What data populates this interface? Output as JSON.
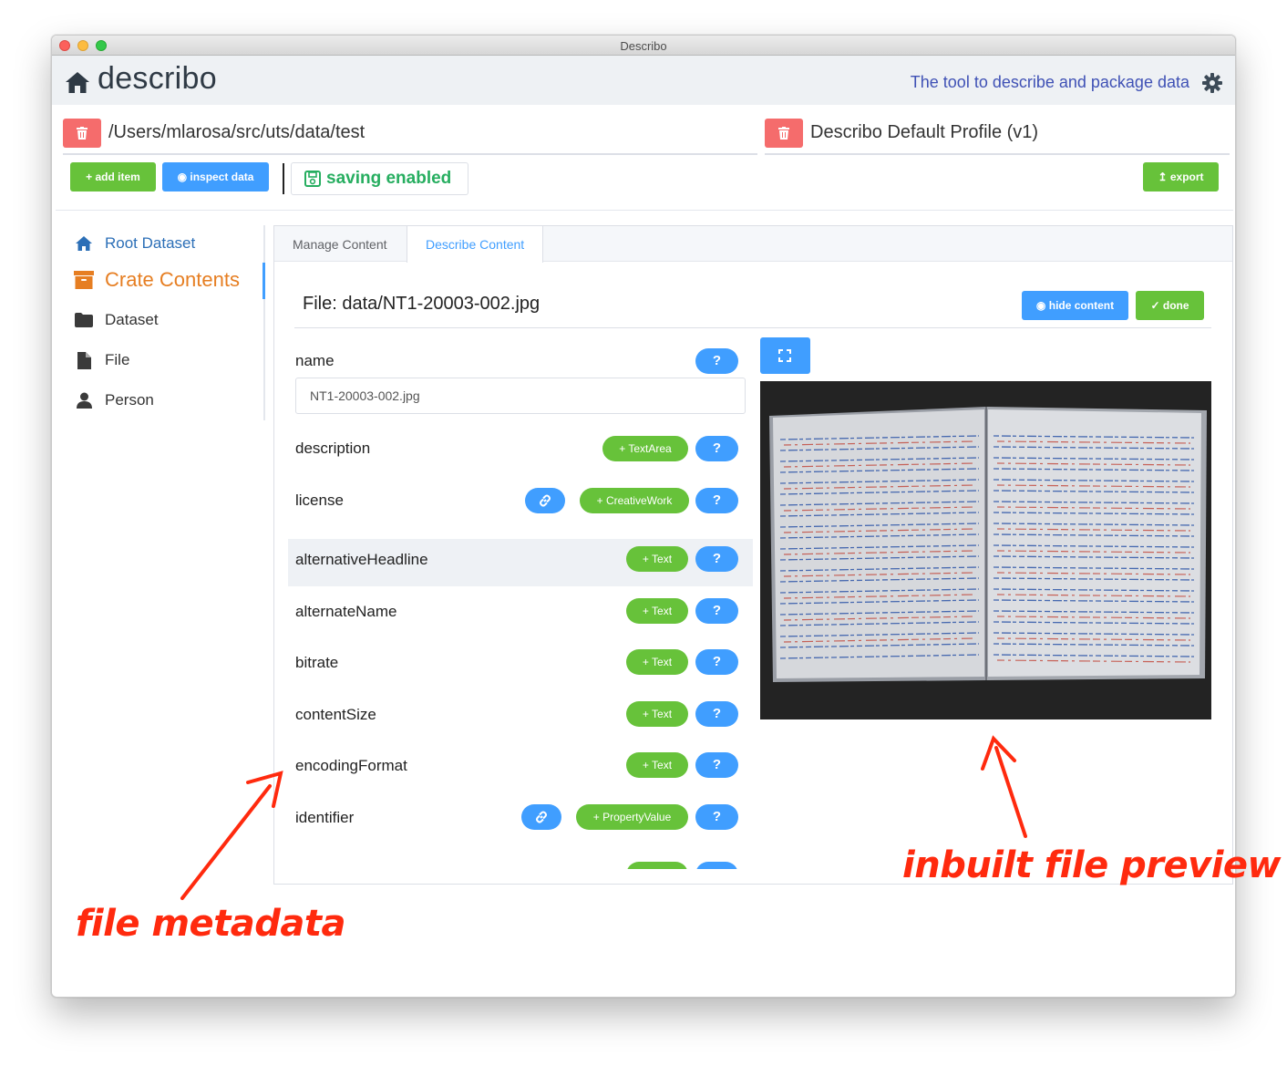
{
  "window": {
    "title": "Describo"
  },
  "header": {
    "app_name": "describo",
    "tagline": "The tool to describe and package data"
  },
  "paths": {
    "folder": "/Users/mlarosa/src/uts/data/test",
    "profile": "Describo Default Profile (v1)"
  },
  "toolbar": {
    "add_item": "add item",
    "inspect_data": "inspect data",
    "saving": "saving enabled",
    "export": "export"
  },
  "sidebar": {
    "items": [
      {
        "label": "Root Dataset",
        "icon": "home-icon",
        "color": "#2c6fb7"
      },
      {
        "label": "Crate Contents",
        "icon": "archive-icon",
        "color": "#e67e22",
        "active": true
      },
      {
        "label": "Dataset",
        "icon": "folder-icon",
        "color": "#333333"
      },
      {
        "label": "File",
        "icon": "file-icon",
        "color": "#333333"
      },
      {
        "label": "Person",
        "icon": "user-icon",
        "color": "#333333"
      }
    ]
  },
  "tabs": [
    {
      "label": "Manage Content",
      "active": false
    },
    {
      "label": "Describe Content",
      "active": true
    }
  ],
  "file": {
    "title": "File: data/NT1-20003-002.jpg",
    "hide_content": "hide content",
    "done": "done",
    "name_value": "NT1-20003-002.jpg"
  },
  "properties": [
    {
      "name": "name",
      "help": "?"
    },
    {
      "name": "description",
      "add": "TextArea",
      "help": "?"
    },
    {
      "name": "license",
      "add": "CreativeWork",
      "link": true,
      "help": "?"
    },
    {
      "name": "alternativeHeadline",
      "add": "Text",
      "help": "?",
      "highlighted": true
    },
    {
      "name": "alternateName",
      "add": "Text",
      "help": "?"
    },
    {
      "name": "bitrate",
      "add": "Text",
      "help": "?"
    },
    {
      "name": "contentSize",
      "add": "Text",
      "help": "?"
    },
    {
      "name": "encodingFormat",
      "add": "Text",
      "help": "?"
    },
    {
      "name": "identifier",
      "add": "PropertyValue",
      "link": true,
      "help": "?"
    }
  ],
  "annotations": {
    "left": "file metadata",
    "right": "inbuilt file preview"
  },
  "colors": {
    "green": "#67c23a",
    "blue": "#409eff",
    "red": "#f56c6c",
    "annotation": "#ff2a0e"
  }
}
